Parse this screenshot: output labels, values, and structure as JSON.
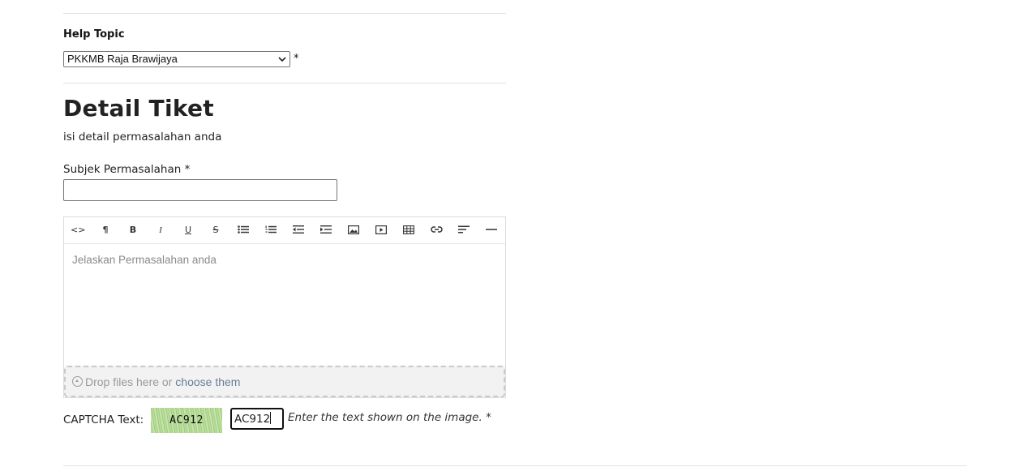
{
  "help_topic": {
    "label": "Help Topic",
    "selected": "PKKMB Raja Brawijaya",
    "required_mark": "*"
  },
  "details": {
    "title": "Detail Tiket",
    "subtitle": "isi detail permasalahan anda"
  },
  "subject": {
    "label": "Subjek Permasalahan *",
    "value": ""
  },
  "editor": {
    "toolbar": [
      {
        "name": "html-code-icon",
        "glyph": "<>"
      },
      {
        "name": "paragraph-icon",
        "glyph": "¶"
      },
      {
        "name": "bold-icon",
        "glyph": "B"
      },
      {
        "name": "italic-icon",
        "glyph": "I"
      },
      {
        "name": "underline-icon",
        "glyph": "U"
      },
      {
        "name": "strikethrough-icon",
        "glyph": "S"
      },
      {
        "name": "bulleted-list-icon",
        "glyph": ""
      },
      {
        "name": "numbered-list-icon",
        "glyph": ""
      },
      {
        "name": "outdent-icon",
        "glyph": ""
      },
      {
        "name": "indent-icon",
        "glyph": ""
      },
      {
        "name": "image-icon",
        "glyph": ""
      },
      {
        "name": "video-icon",
        "glyph": ""
      },
      {
        "name": "table-icon",
        "glyph": ""
      },
      {
        "name": "link-icon",
        "glyph": ""
      },
      {
        "name": "align-icon",
        "glyph": ""
      },
      {
        "name": "horizontal-rule-icon",
        "glyph": ""
      }
    ],
    "placeholder": "Jelaskan Permasalahan anda"
  },
  "dropzone": {
    "text": "Drop files here or",
    "link": "choose them"
  },
  "captcha": {
    "label": "CAPTCHA Text:",
    "image_text": "AC912",
    "input_value": "AC912",
    "hint": "Enter the text shown on the image. *"
  }
}
